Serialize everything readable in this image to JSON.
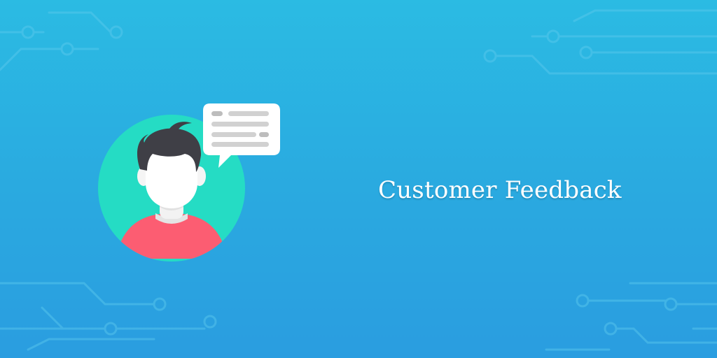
{
  "title": "Customer Feedback",
  "illustration": {
    "subject": "user-avatar",
    "icons": [
      "user-avatar-icon",
      "speech-bubble-icon"
    ]
  },
  "colors": {
    "background_top": "#2bbbe3",
    "background_bottom": "#2a9de0",
    "avatar_circle": "#25dcc4",
    "shirt": "#fc5d72",
    "hair": "#3f3f46",
    "speech_bubble": "#ffffff",
    "speech_lines": "#bdbdbd",
    "circuit_lines": "#5ecbee"
  }
}
